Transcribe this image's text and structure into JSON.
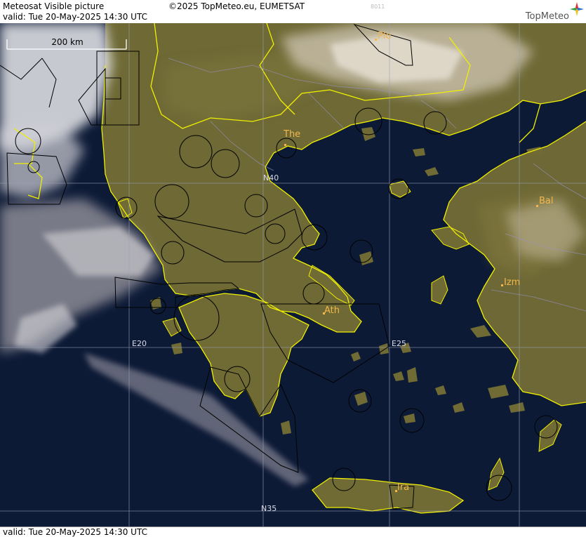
{
  "header": {
    "title": "Meteosat Visible picture",
    "copyright": "©2025 TopMeteo.eu, EUMETSAT",
    "valid_top": "valid:  Tue  20-May-2025  14:30 UTC",
    "code": "8011",
    "brand": "TopMeteo"
  },
  "footer": {
    "valid_bottom": "valid:  Tue  20-May-2025  14:30 UTC"
  },
  "map": {
    "scale_label": "200 km",
    "graticule": {
      "lat1": "N40",
      "lat2": "N35",
      "lon1": "E20",
      "lon2": "E25"
    },
    "cities": [
      {
        "name": "Plo"
      },
      {
        "name": "The"
      },
      {
        "name": "Bal"
      },
      {
        "name": "Izm"
      },
      {
        "name": "Ath"
      },
      {
        "name": "Ira"
      }
    ]
  },
  "colors": {
    "sea": "#0d1a36",
    "land": "#6f6a36",
    "border": "#f0f000",
    "city_label": "#f2b84a",
    "grid": "#9aa0b8"
  }
}
